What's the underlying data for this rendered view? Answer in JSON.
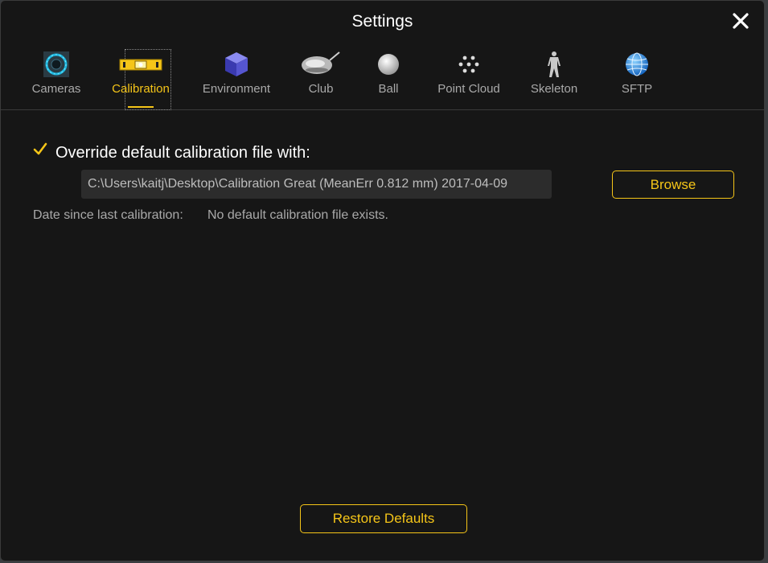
{
  "window": {
    "title": "Settings"
  },
  "tabs": [
    {
      "label": "Cameras",
      "icon": "camera-ring-icon"
    },
    {
      "label": "Calibration",
      "icon": "spirit-level-icon",
      "active": true
    },
    {
      "label": "Environment",
      "icon": "cube-icon"
    },
    {
      "label": "Club",
      "icon": "golf-club-icon"
    },
    {
      "label": "Ball",
      "icon": "golf-ball-icon"
    },
    {
      "label": "Point Cloud",
      "icon": "point-cloud-icon"
    },
    {
      "label": "Skeleton",
      "icon": "skeleton-icon"
    },
    {
      "label": "SFTP",
      "icon": "globe-icon"
    }
  ],
  "calibration": {
    "override_checked": true,
    "override_label": "Override default calibration file with:",
    "file_path": "C:\\Users\\kaitj\\Desktop\\Calibration Great (MeanErr 0.812 mm) 2017-04-09",
    "browse_label": "Browse",
    "date_label": "Date since last calibration:",
    "date_value": "No default calibration file exists."
  },
  "footer": {
    "restore_label": "Restore Defaults"
  },
  "colors": {
    "accent": "#f5c518",
    "background": "#161616",
    "field": "#2c2c2c"
  }
}
